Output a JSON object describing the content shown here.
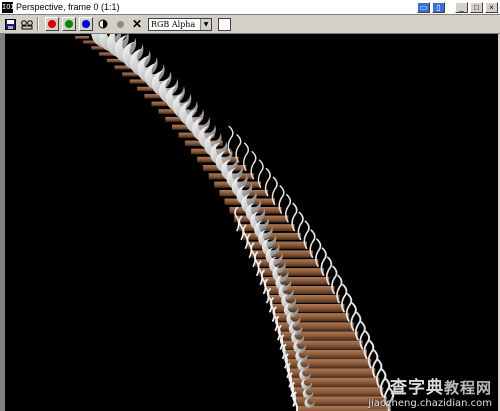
{
  "window": {
    "title": "Perspective, frame 0 (1:1)",
    "app_icon_text": "IOI"
  },
  "toolbar": {
    "channel_value": "RGB Alpha",
    "color_dots": [
      "#d40000",
      "#008800",
      "#0000cc"
    ],
    "swatch_color": "#ffffff"
  },
  "watermark": {
    "brand": "查字典",
    "brand_sub": "教程网",
    "url": "jiaocheng.chazidian.com"
  }
}
